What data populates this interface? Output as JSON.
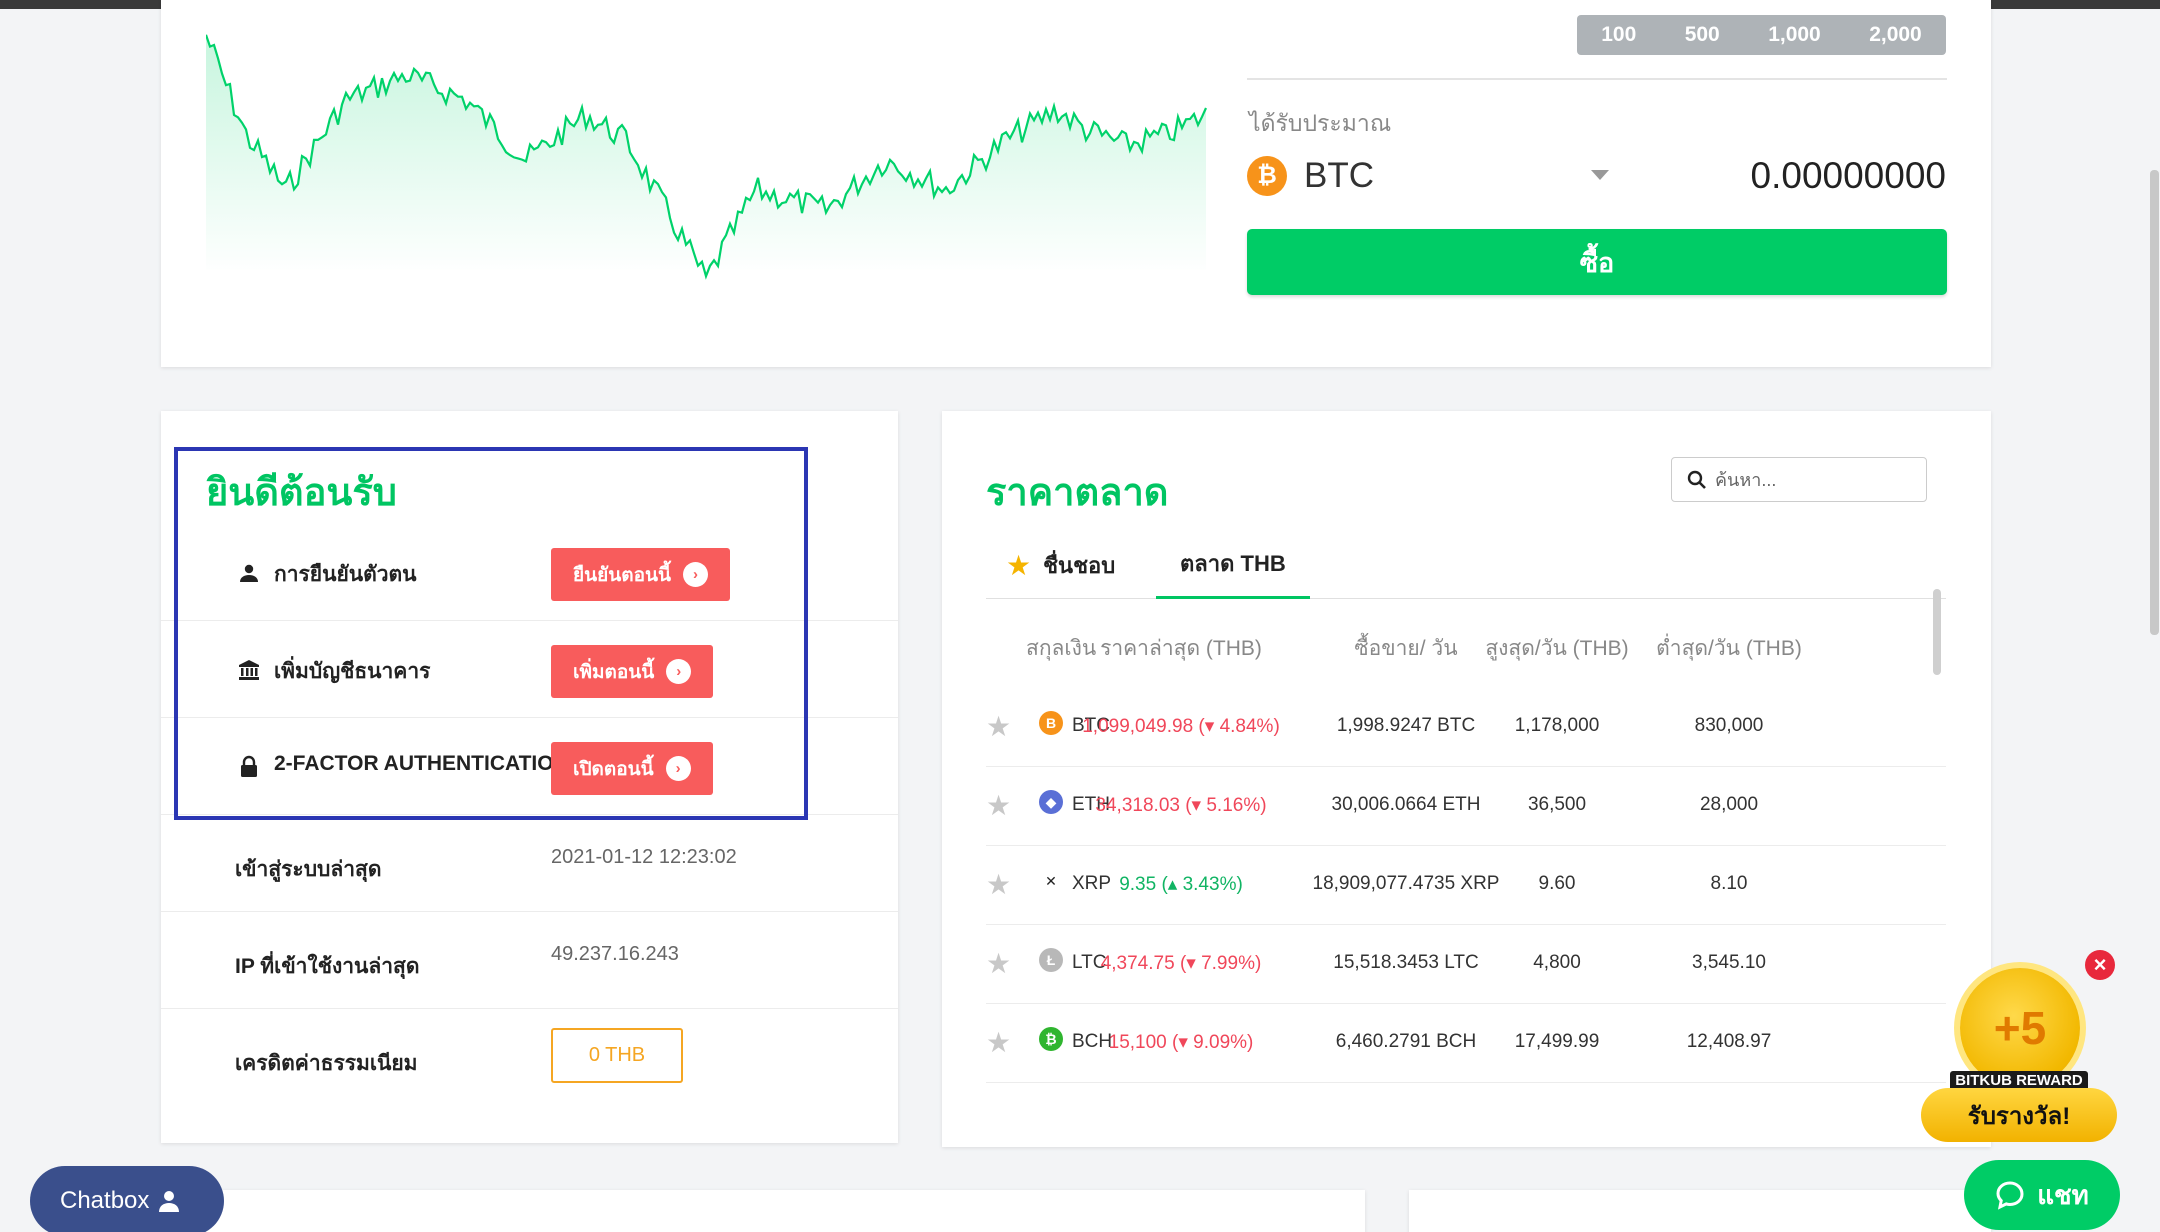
{
  "order_panel": {
    "amount_options": [
      "100",
      "500",
      "1,000",
      "2,000"
    ],
    "receive_label": "ได้รับประมาณ",
    "coin": "BTC",
    "receive_value": "0.00000000",
    "buy_label": "ซื้อ"
  },
  "welcome": {
    "title": "ยินดีต้อนรับ",
    "actions": [
      {
        "label": "การยืนยันตัวตน",
        "button": "ยืนยันตอนนี้",
        "icon": "user-icon"
      },
      {
        "label": "เพิ่มบัญชีธนาคาร",
        "button": "เพิ่มตอนนี้",
        "icon": "bank-icon"
      },
      {
        "label": "2-FACTOR AUTHENTICATION",
        "button": "เปิดตอนนี้",
        "icon": "lock-icon"
      }
    ],
    "last_login_label": "เข้าสู่ระบบล่าสุด",
    "last_login_value": "2021-01-12 12:23:02",
    "last_ip_label": "IP ที่เข้าใช้งานล่าสุด",
    "last_ip_value": "49.237.16.243",
    "fee_credit_label": "เครดิตค่าธรรมเนียม",
    "fee_credit_value": "0 THB"
  },
  "market": {
    "title": "ราคาตลาด",
    "search_placeholder": "ค้นหา...",
    "tabs": [
      "ชื่นชอบ",
      "ตลาด THB"
    ],
    "columns": [
      "สกุลเงิน",
      "ราคาล่าสุด (THB)",
      "ซื้อขาย/ วัน",
      "สูงสุด/วัน (THB)",
      "ต่ำสุด/วัน (THB)"
    ],
    "rows": [
      {
        "symbol": "BTC",
        "price": "1,099,049.98 (▾ 4.84%)",
        "volume": "1,998.9247 BTC",
        "high": "1,178,000",
        "low": "830,000",
        "trend": "down",
        "color": "#f7931a",
        "glyph": "B"
      },
      {
        "symbol": "ETH",
        "price": "34,318.03 (▾ 5.16%)",
        "volume": "30,006.0664 ETH",
        "high": "36,500",
        "low": "28,000",
        "trend": "down",
        "color": "#5a6fd6",
        "glyph": "◆"
      },
      {
        "symbol": "XRP",
        "price": "9.35 (▴ 3.43%)",
        "volume": "18,909,077.4735 XRP",
        "high": "9.60",
        "low": "8.10",
        "trend": "up",
        "color": "#222222",
        "glyph": "✕"
      },
      {
        "symbol": "LTC",
        "price": "4,374.75 (▾ 7.99%)",
        "volume": "15,518.3453 LTC",
        "high": "4,800",
        "low": "3,545.10",
        "trend": "down",
        "color": "#b8b8b8",
        "glyph": "Ł"
      },
      {
        "symbol": "BCH",
        "price": "15,100 (▾ 9.09%)",
        "volume": "6,460.2791 BCH",
        "high": "17,499.99",
        "low": "12,408.97",
        "trend": "down",
        "color": "#2fb52f",
        "glyph": "₿"
      }
    ]
  },
  "chatbox_label": "Chatbox",
  "chat_label": "แชท",
  "reward": {
    "points": "+5",
    "tag": "BITKUB REWARD",
    "claim": "รับรางวัล!"
  },
  "colors": {
    "accent": "#00c562",
    "buy": "#00cc66",
    "danger": "#f85c5c",
    "highlight": "#2b36b3"
  }
}
